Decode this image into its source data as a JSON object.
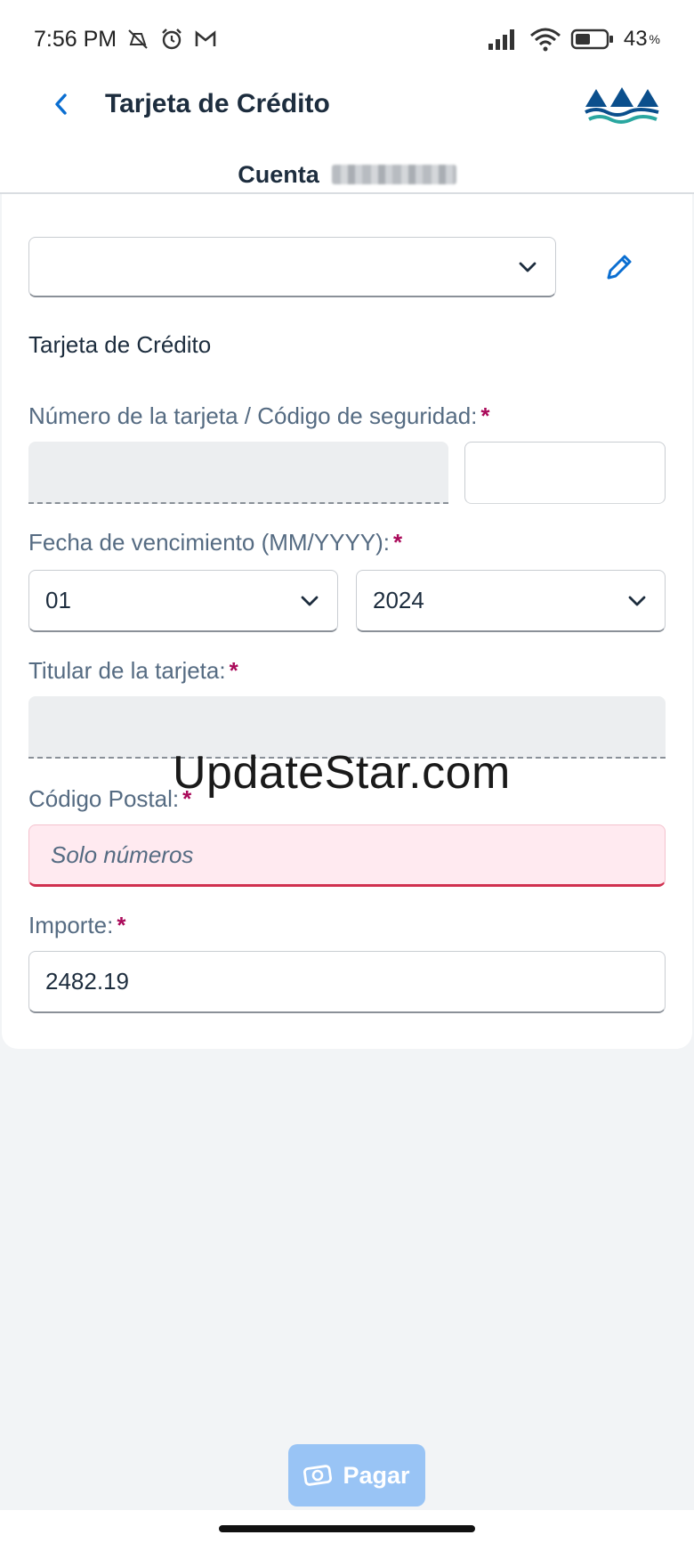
{
  "status_bar": {
    "time": "7:56 PM",
    "battery": "43"
  },
  "header": {
    "title": "Tarjeta de Crédito",
    "account_label": "Cuenta"
  },
  "form": {
    "section_title": "Tarjeta de Crédito",
    "card_number_label": "Número de la tarjeta / Código de seguridad:",
    "expiry_label": "Fecha de vencimiento (MM/YYYY):",
    "expiry_month": "01",
    "expiry_year": "2024",
    "holder_label": "Titular de la tarjeta:",
    "postal_label": "Código Postal:",
    "postal_placeholder": "Solo números",
    "amount_label": "Importe:",
    "amount_value": "2482.19",
    "required_mark": "*"
  },
  "watermark": "UpdateStar.com",
  "actions": {
    "pay_label": "Pagar"
  },
  "colors": {
    "required": "#aa0a5a",
    "accent": "#0a6ed1",
    "error_border": "#d0304f",
    "pay_button": "#99c4f5"
  },
  "icons": [
    "silent-icon",
    "alarm-icon",
    "gmail-icon",
    "signal-icon",
    "wifi-icon",
    "battery-icon",
    "back-chevron-icon",
    "logo-icon",
    "chevron-down-icon",
    "pencil-icon",
    "cash-icon"
  ]
}
